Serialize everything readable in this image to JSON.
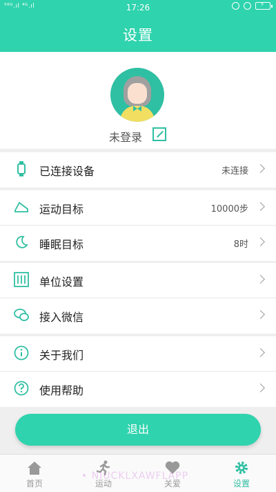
{
  "status_bar": {
    "signal": "⁵⁶ᴳ.ıl ⁴ᴳ.ıl",
    "time": "17:26"
  },
  "header": {
    "title": "设置"
  },
  "profile": {
    "login_text": "未登录"
  },
  "groups": [
    {
      "items": [
        {
          "icon": "watch-icon",
          "label": "已连接设备",
          "value": "未连接"
        }
      ]
    },
    {
      "items": [
        {
          "icon": "running-shoe-icon",
          "label": "运动目标",
          "value": "10000步"
        },
        {
          "icon": "moon-icon",
          "label": "睡眠目标",
          "value": "8时"
        }
      ]
    },
    {
      "items": [
        {
          "icon": "sliders-icon",
          "label": "单位设置",
          "value": ""
        },
        {
          "icon": "wechat-icon",
          "label": "接入微信",
          "value": ""
        }
      ]
    },
    {
      "items": [
        {
          "icon": "info-icon",
          "label": "关于我们",
          "value": ""
        },
        {
          "icon": "help-icon",
          "label": "使用帮助",
          "value": ""
        }
      ]
    }
  ],
  "logout": {
    "label": "退出"
  },
  "tabs": [
    {
      "icon": "home-icon",
      "label": "首页",
      "active": false
    },
    {
      "icon": "running-icon",
      "label": "运动",
      "active": false
    },
    {
      "icon": "heart-icon",
      "label": "关爱",
      "active": false
    },
    {
      "icon": "gear-icon",
      "label": "设置",
      "active": true
    }
  ],
  "watermark": "• NIUCKLXAWFLAPP",
  "colors": {
    "accent": "#2fd3ad",
    "accent_dark": "#2fbfa2",
    "background": "#efefef"
  }
}
